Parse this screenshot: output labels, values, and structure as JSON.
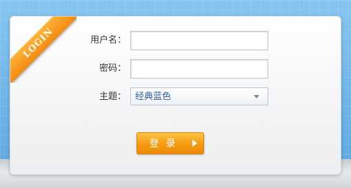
{
  "badge": {
    "text": "LOGIN"
  },
  "form": {
    "username_label": "用户名：",
    "username_value": "",
    "password_label": "密码：",
    "password_value": "",
    "theme_label": "主题：",
    "theme_selected": "经典蓝色",
    "submit_label": "登录"
  },
  "icons": {
    "dropdown": "chevron-down-icon",
    "submit": "play-icon"
  },
  "colors": {
    "accent": "#f59a0f",
    "background": "#6fb3e8",
    "select_text": "#2f5f9e"
  }
}
